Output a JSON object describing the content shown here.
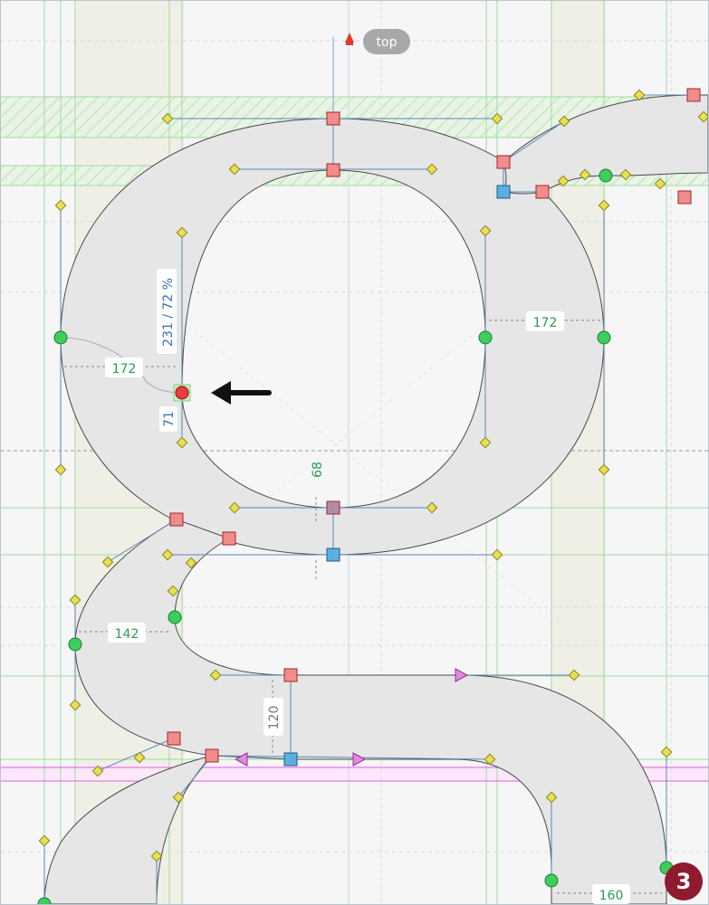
{
  "guides": {
    "top_label": "top"
  },
  "measurements": {
    "counter_left_width": "172",
    "counter_right_width": "172",
    "tension_ratio": "231 / 72 %",
    "handle_length": "71",
    "bottom_gap": "68",
    "neck_width": "142",
    "stem_height": "120",
    "tail_width": "160"
  },
  "badge": {
    "count": "3"
  },
  "colors": {
    "stroke_fill": "#e6e6e6",
    "guide_green": "#7ad17a",
    "guide_magenta": "#e04be0",
    "on_curve_smooth": "#3ccf5a",
    "on_curve_corner": "#f08c8c",
    "off_curve": "#e8e050",
    "selected_node": "#f03c3c",
    "measure_text": "#2e9a4e",
    "metric_text": "#3b73b4",
    "badge": "#8e1b2e"
  },
  "icons": [
    "top-anchor-icon",
    "pointer-arrow-icon",
    "node-icons",
    "handle-icons"
  ]
}
